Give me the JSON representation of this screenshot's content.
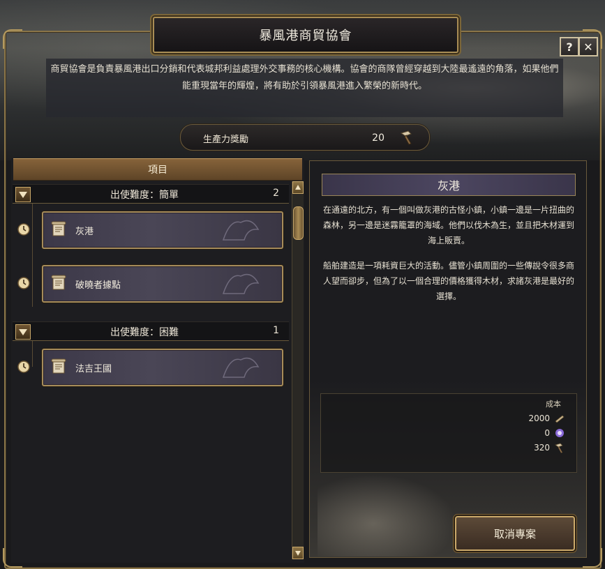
{
  "window": {
    "title": "暴風港商貿協會",
    "help_label": "?",
    "close_label": "✕"
  },
  "description": "商貿協會是負責暴風港出口分銷和代表城邦利益處理外交事務的核心機構。協會的商隊曾經穿越到大陸最遙遠的角落，如果他們能重現當年的輝煌，將有助於引領暴風港進入繁榮的新時代。",
  "productivity": {
    "label": "生產力獎勵",
    "value": "20",
    "icon": "hammer-icon"
  },
  "list": {
    "header": "項目",
    "categories": [
      {
        "label": "出使難度：簡單",
        "count": "2",
        "items": [
          {
            "label": "灰港",
            "icon": "scroll-icon",
            "status_icon": "clock-icon"
          },
          {
            "label": "破曉者據點",
            "icon": "scroll-icon",
            "status_icon": "clock-icon"
          }
        ]
      },
      {
        "label": "出使難度：困難",
        "count": "1",
        "items": [
          {
            "label": "法吉王國",
            "icon": "scroll-icon",
            "status_icon": "clock-icon"
          }
        ]
      }
    ]
  },
  "detail": {
    "title": "灰港",
    "paragraph1": "在通遠的北方，有一個叫做灰港的古怪小鎮，小鎮一邊是一片扭曲的森林，另一邊是迷霧籠罩的海域。他們以伐木為生，並且把木材運到海上販賣。",
    "paragraph2": "船舶建造是一項耗資巨大的活動。儘管小鎮周圍的一些傳說令很多商人望而卻步，但為了以一個合理的價格獲得木材，求諸灰港是最好的選擇。",
    "cost": {
      "title": "成本",
      "rows": [
        {
          "value": "2000",
          "icon": "coin-icon"
        },
        {
          "value": "0",
          "icon": "magic-orb-icon"
        },
        {
          "value": "320",
          "icon": "hammer-icon"
        }
      ]
    },
    "cancel_label": "取消專案"
  },
  "colors": {
    "gold_border": "#a68c5a",
    "item_bg": "#4a4656",
    "header_bg": "#86633a"
  }
}
